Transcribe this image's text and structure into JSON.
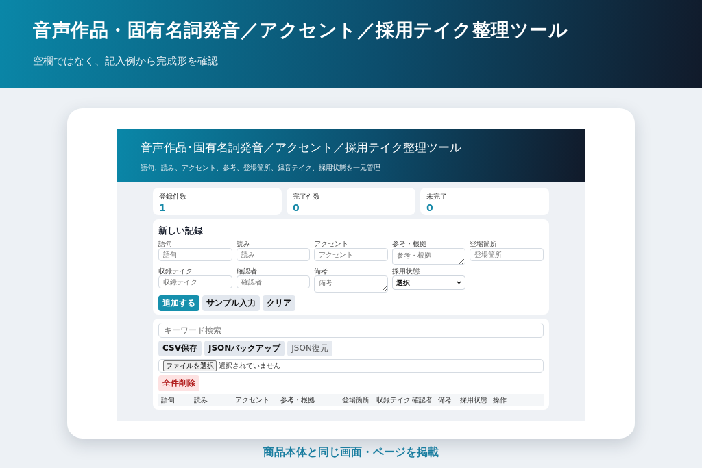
{
  "banner": {
    "title": "音声作品・固有名詞発音／アクセント／採用テイク整理ツール",
    "subtitle": "空欄ではなく、記入例から完成形を確認"
  },
  "app": {
    "title": "音声作品･固有名詞発音／アクセント／採用テイク整理ツール",
    "subtitle": "語句、読み、アクセント、参考、登場箇所、録音テイク、採用状態を一元管理",
    "stats": [
      {
        "label": "登録件数",
        "value": "1"
      },
      {
        "label": "完了件数",
        "value": "0"
      },
      {
        "label": "未完了",
        "value": "0"
      }
    ],
    "form": {
      "title": "新しい記録",
      "fields": [
        {
          "label": "語句",
          "kind": "input",
          "placeholder": "語句"
        },
        {
          "label": "読み",
          "kind": "input",
          "placeholder": "読み"
        },
        {
          "label": "アクセント",
          "kind": "input",
          "placeholder": "アクセント"
        },
        {
          "label": "参考・根拠",
          "kind": "textarea",
          "placeholder": "参考・根拠"
        },
        {
          "label": "登場箇所",
          "kind": "input",
          "placeholder": "登場箇所"
        },
        {
          "label": "収録テイク",
          "kind": "input",
          "placeholder": "収録テイク"
        },
        {
          "label": "確認者",
          "kind": "input",
          "placeholder": "確認者"
        },
        {
          "label": "備考",
          "kind": "textarea",
          "placeholder": "備考"
        },
        {
          "label": "採用状態",
          "kind": "select",
          "value": "選択"
        }
      ],
      "buttons": [
        {
          "label": "追加する",
          "kind": "primary"
        },
        {
          "label": "サンプル入力",
          "kind": "secondary"
        },
        {
          "label": "クリア",
          "kind": "secondary"
        }
      ]
    },
    "tools": {
      "search": {
        "placeholder": "キーワード検索"
      },
      "buttons": [
        {
          "label": "CSV保存",
          "kind": "secondary"
        },
        {
          "label": "JSONバックアップ",
          "kind": "secondary"
        },
        {
          "label": "JSON復元",
          "kind": "light"
        }
      ],
      "file": {
        "button": "ファイルを選択",
        "status": "選択されていません"
      },
      "danger_button": "全件削除",
      "columns": [
        "語句",
        "読み",
        "アクセント",
        "参考・根拠",
        "登場箇所",
        "収録テイク",
        "確認者",
        "備考",
        "採用状態",
        "操作"
      ]
    }
  },
  "caption": "商品本体と同じ画面・ページを掲載"
}
